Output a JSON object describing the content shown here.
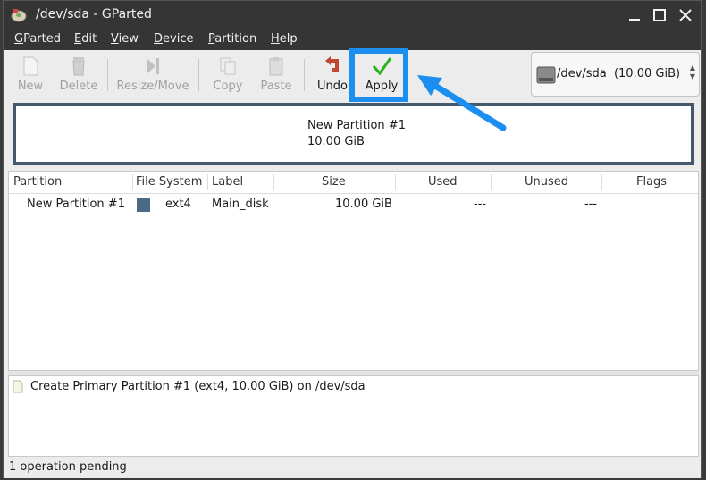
{
  "window": {
    "title": "/dev/sda - GParted"
  },
  "menu": [
    {
      "label": "GParted",
      "mnemonic": "G",
      "rest": "Parted"
    },
    {
      "label": "Edit",
      "mnemonic": "E",
      "rest": "dit"
    },
    {
      "label": "View",
      "mnemonic": "V",
      "rest": "iew"
    },
    {
      "label": "Device",
      "mnemonic": "D",
      "rest": "evice"
    },
    {
      "label": "Partition",
      "mnemonic": "P",
      "rest": "artition"
    },
    {
      "label": "Help",
      "mnemonic": "H",
      "rest": "elp"
    }
  ],
  "toolbar": {
    "new": "New",
    "delete": "Delete",
    "resize_move": "Resize/Move",
    "copy": "Copy",
    "paste": "Paste",
    "undo": "Undo",
    "apply": "Apply"
  },
  "device_selector": {
    "device": "/dev/sda",
    "size": "(10.00 GiB)"
  },
  "disk_map": {
    "partition_name": "New Partition #1",
    "partition_size": "10.00 GiB",
    "partition_color": "#44596e"
  },
  "table": {
    "headers": [
      "Partition",
      "File System",
      "Label",
      "Size",
      "Used",
      "Unused",
      "Flags"
    ],
    "rows": [
      {
        "partition": "New Partition #1",
        "fs_color": "#4a6a85",
        "filesystem": "ext4",
        "label": "Main_disk",
        "size": "10.00 GiB",
        "used": "---",
        "unused": "---",
        "flags": ""
      }
    ]
  },
  "operations": {
    "items": [
      "Create Primary Partition #1 (ext4, 10.00 GiB) on /dev/sda"
    ]
  },
  "status": {
    "text": "1 operation pending"
  },
  "annotation": {
    "highlight_color": "#1b8ef0"
  }
}
